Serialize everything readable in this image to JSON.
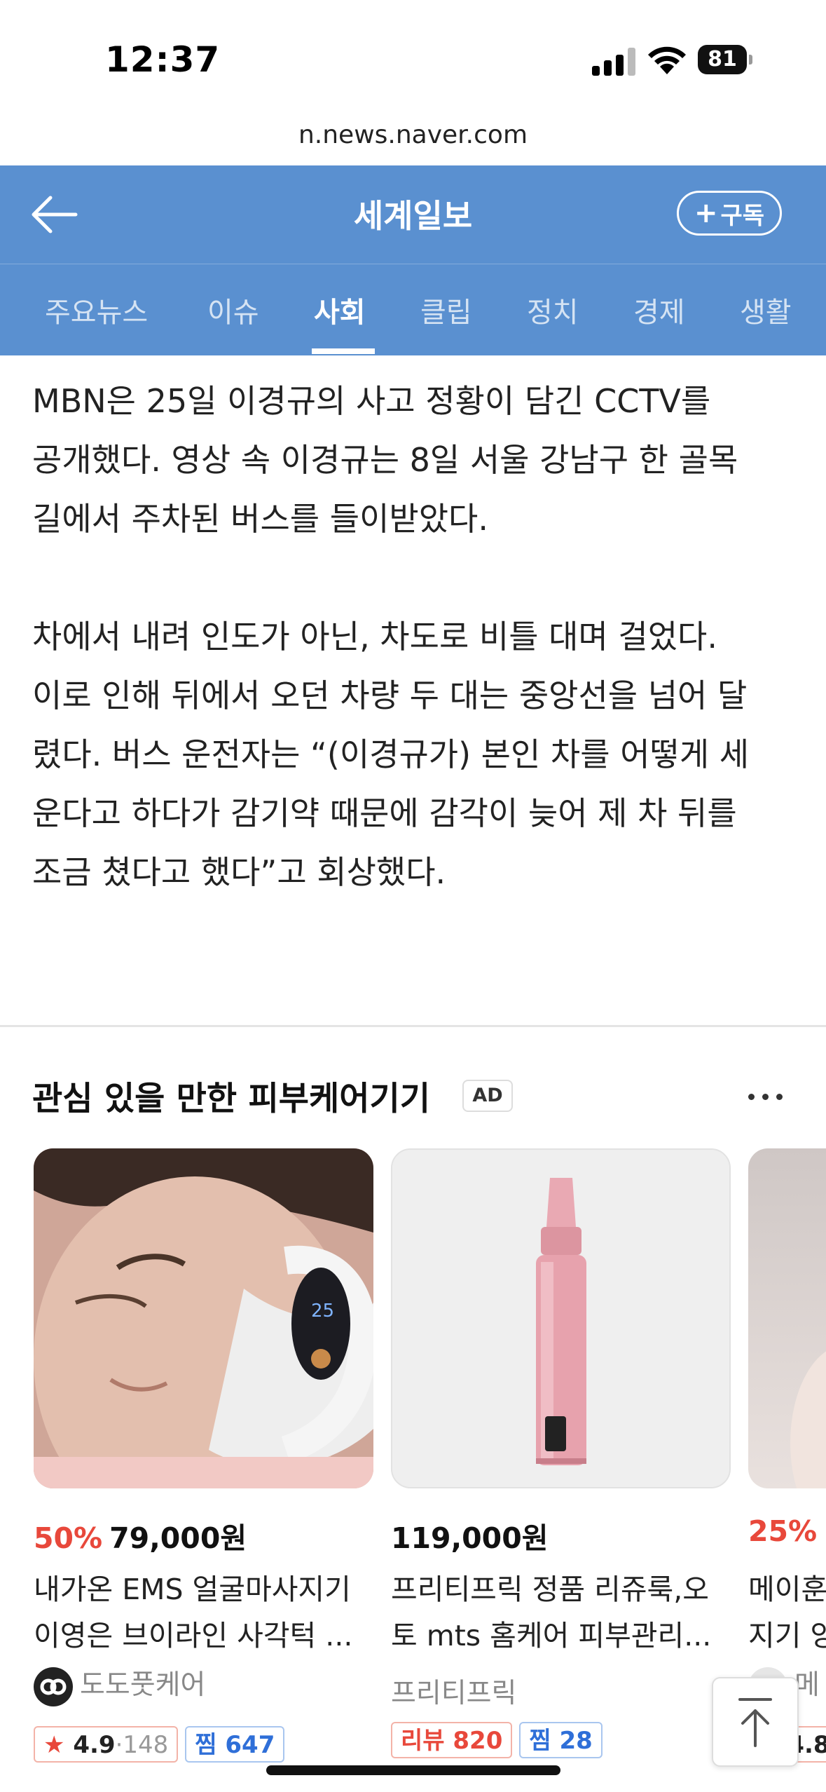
{
  "status_bar": {
    "time": "12:37",
    "battery": "81"
  },
  "browser": {
    "url": "n.news.naver.com"
  },
  "header": {
    "brand": "세계일보",
    "subscribe_label": "구독"
  },
  "tabs": [
    {
      "label": "주요뉴스",
      "active": false
    },
    {
      "label": "이슈",
      "active": false
    },
    {
      "label": "사회",
      "active": true
    },
    {
      "label": "클립",
      "active": false
    },
    {
      "label": "정치",
      "active": false
    },
    {
      "label": "경제",
      "active": false
    },
    {
      "label": "생활",
      "active": false
    }
  ],
  "article": {
    "paragraphs": [
      [
        "MBN은 25일 이경규의 사고 정황이 담긴 CCTV를",
        "공개했다. 영상 속 이경규는 8일 서울 강남구 한 골목",
        "길에서 주차된 버스를 들이받았다."
      ],
      [
        "차에서 내려 인도가 아닌, 차도로 비틀 대며 걸었다.",
        "이로 인해 뒤에서 오던 차량 두 대는 중앙선을 넘어 달",
        "렸다. 버스 운전자는 “(이경규가) 본인 차를 어떻게 세",
        "운다고 하다가 감기약 때문에 감각이 늦어 제 차 뒤를",
        "조금 쳤다고 했다”고 회상했다."
      ]
    ]
  },
  "ad_section": {
    "title": "관심 있을 만한 피부케어기기",
    "badge": "AD",
    "products": [
      {
        "discount": "50%",
        "price": "79,000원",
        "name_lines": [
          "내가온 EMS 얼굴마사지기",
          "이영은 브이라인 사각턱 ..."
        ],
        "seller": "도도풋케어",
        "rating": "4.9",
        "rating_count": "148",
        "zzim": "찜 647"
      },
      {
        "discount": "",
        "price": "119,000원",
        "name_lines": [
          "프리티프릭 정품 리쥬룩,오",
          "토 mts 홈케어 피부관리..."
        ],
        "seller": "프리티프릭",
        "review": "리뷰 820",
        "zzim": "찜 28"
      },
      {
        "discount": "25%",
        "price": "",
        "name_lines": [
          "메이훈",
          "지기 양"
        ],
        "seller": "메",
        "rating": "4.8"
      }
    ]
  },
  "colors": {
    "brand_blue": "#5a90d0",
    "discount_red": "#e8483b",
    "zzim_blue": "#2f6fd8"
  },
  "icons": [
    "back-arrow-icon",
    "plus-icon",
    "more-dots-icon",
    "star-icon",
    "scroll-top-icon",
    "signal-icon",
    "wifi-icon",
    "battery-icon"
  ]
}
